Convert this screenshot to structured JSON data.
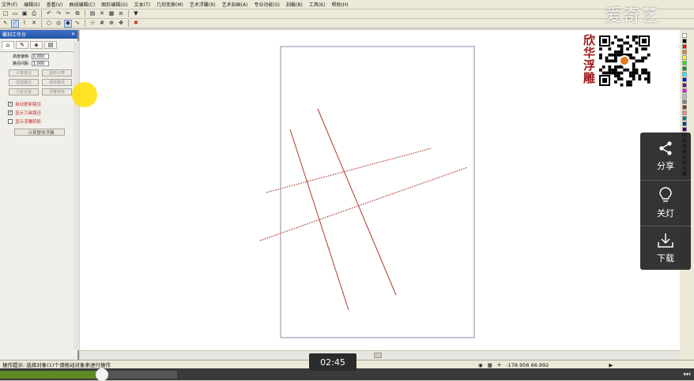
{
  "menu": [
    "文件(F)",
    "编辑(E)",
    "查看(V)",
    "曲线编辑(C)",
    "图形编辑(G)",
    "文本(T)",
    "几何变换(M)",
    "艺术浮雕(R)",
    "艺术刻画(A)",
    "专业功能(S)",
    "刻截(B)",
    "工具(K)",
    "帮助(H)"
  ],
  "toolbar1": [
    "new-icon",
    "open-icon",
    "save-icon",
    "print-icon",
    "undo-icon",
    "redo-icon",
    "cut-icon",
    "copy-icon",
    "paste-icon",
    "delete-icon",
    "group-icon",
    "layer-icon",
    "filter-icon"
  ],
  "toolbar2": [
    "pointer-icon",
    "line-icon",
    "polyline-icon",
    "cross-icon",
    "circle-icon",
    "target-icon",
    "node-icon",
    "spline-icon",
    "snap-icon",
    "grid-icon",
    "zoom-icon",
    "pan-icon",
    "close-icon"
  ],
  "panel": {
    "title": "雕刻工作台",
    "tabs": [
      "tab-a",
      "tab-b",
      "tab-c",
      "tab-d"
    ],
    "fields": [
      {
        "label": "高度偏移:",
        "value": "0.000"
      },
      {
        "label": "路径间距:",
        "value": "1.000"
      }
    ],
    "buttons": [
      "计算路径",
      "重新计算",
      "加载路径",
      "保存路径",
      "刀具设置",
      "浮雕参数"
    ],
    "checks": [
      {
        "label": "自动更新路径",
        "checked": true
      },
      {
        "label": "显示刀具路径",
        "checked": true
      },
      {
        "label": "显示浮雕阴影",
        "checked": false
      }
    ],
    "bottom_button": "计算整体浮雕"
  },
  "status": {
    "left": "操作提示: 选择对象(1)个请拖动对象来进行操作",
    "coords": "-178.956  66.992"
  },
  "video": {
    "time": "02:45",
    "progress": 0.15,
    "buffered": 0.26,
    "watermark": "爱奇艺"
  },
  "brand": {
    "chars": [
      "欣",
      "华",
      "浮",
      "雕"
    ]
  },
  "side": {
    "share": "分享",
    "light": "关灯",
    "download": "下载"
  },
  "colors": {
    "line": "#b03a2e",
    "palette": [
      "#ffffff",
      "#000000",
      "#ff0000",
      "#ff7f00",
      "#ffff00",
      "#00ff00",
      "#00a000",
      "#00ffff",
      "#0000ff",
      "#800080",
      "#ff00ff",
      "#c0c0c0",
      "#808080",
      "#804000",
      "#ff8080",
      "#008080",
      "#004080",
      "#400080",
      "#808000",
      "#2f4f4f",
      "#556b2f",
      "#8b0000",
      "#483d8b",
      "#006400",
      "#b8860b",
      "#1a1a1a"
    ]
  }
}
